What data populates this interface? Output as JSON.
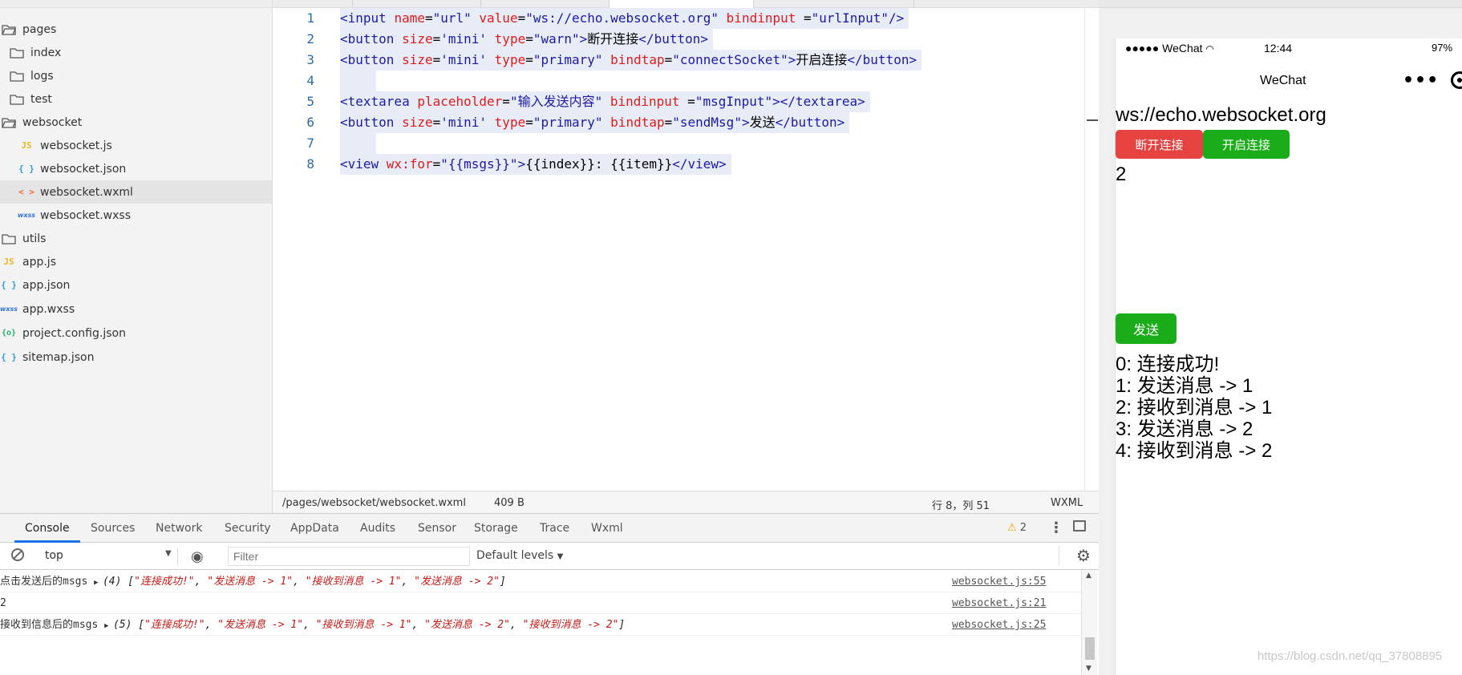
{
  "sidebar": {
    "items": [
      {
        "label": "pages",
        "type": "folder-open"
      },
      {
        "label": "index",
        "type": "folder"
      },
      {
        "label": "logs",
        "type": "folder"
      },
      {
        "label": "test",
        "type": "folder"
      },
      {
        "label": "websocket",
        "type": "folder-open"
      },
      {
        "label": "websocket.js",
        "type": "js",
        "icon_text": "JS"
      },
      {
        "label": "websocket.json",
        "type": "json",
        "icon_text": "{ }"
      },
      {
        "label": "websocket.wxml",
        "type": "wxml",
        "icon_text": "< >",
        "selected": true
      },
      {
        "label": "websocket.wxss",
        "type": "wxss",
        "icon_text": "wxss"
      },
      {
        "label": "utils",
        "type": "folder"
      },
      {
        "label": "app.js",
        "type": "js",
        "icon_text": "JS"
      },
      {
        "label": "app.json",
        "type": "json",
        "icon_text": "{ }"
      },
      {
        "label": "app.wxss",
        "type": "wxss",
        "icon_text": "wxss"
      },
      {
        "label": "project.config.json",
        "type": "config",
        "icon_text": "{o}"
      },
      {
        "label": "sitemap.json",
        "type": "json",
        "icon_text": "{ }"
      }
    ]
  },
  "editor": {
    "line_numbers": [
      "1",
      "2",
      "3",
      "4",
      "5",
      "6",
      "7",
      "8"
    ],
    "lines": [
      [
        {
          "t": "tg",
          "v": "<input "
        },
        {
          "t": "at",
          "v": "name"
        },
        {
          "t": "tx",
          "v": "="
        },
        {
          "t": "st",
          "v": "\"url\" "
        },
        {
          "t": "at",
          "v": "value"
        },
        {
          "t": "tx",
          "v": "="
        },
        {
          "t": "st",
          "v": "\"ws://echo.websocket.org\" "
        },
        {
          "t": "at",
          "v": "bindinput "
        },
        {
          "t": "tx",
          "v": "="
        },
        {
          "t": "st",
          "v": "\"urlInput\""
        },
        {
          "t": "tg",
          "v": "/>"
        }
      ],
      [
        {
          "t": "tg",
          "v": "<button "
        },
        {
          "t": "at",
          "v": "size"
        },
        {
          "t": "tx",
          "v": "="
        },
        {
          "t": "st",
          "v": "'mini' "
        },
        {
          "t": "at",
          "v": "type"
        },
        {
          "t": "tx",
          "v": "="
        },
        {
          "t": "st",
          "v": "\"warn\""
        },
        {
          "t": "tg",
          "v": ">"
        },
        {
          "t": "tx",
          "v": "断开连接"
        },
        {
          "t": "tg",
          "v": "</button>"
        }
      ],
      [
        {
          "t": "tg",
          "v": "<button "
        },
        {
          "t": "at",
          "v": "size"
        },
        {
          "t": "tx",
          "v": "="
        },
        {
          "t": "st",
          "v": "'mini' "
        },
        {
          "t": "at",
          "v": "type"
        },
        {
          "t": "tx",
          "v": "="
        },
        {
          "t": "st",
          "v": "\"primary\" "
        },
        {
          "t": "at",
          "v": "bindtap"
        },
        {
          "t": "tx",
          "v": "="
        },
        {
          "t": "st",
          "v": "\"connectSocket\""
        },
        {
          "t": "tg",
          "v": ">"
        },
        {
          "t": "tx",
          "v": "开启连接"
        },
        {
          "t": "tg",
          "v": "</button>"
        }
      ],
      [
        {
          "t": "tx",
          "v": "    "
        }
      ],
      [
        {
          "t": "tg",
          "v": "<textarea "
        },
        {
          "t": "at",
          "v": "placeholder"
        },
        {
          "t": "tx",
          "v": "="
        },
        {
          "t": "st",
          "v": "\"输入发送内容\" "
        },
        {
          "t": "at",
          "v": "bindinput "
        },
        {
          "t": "tx",
          "v": "="
        },
        {
          "t": "st",
          "v": "\"msgInput\""
        },
        {
          "t": "tg",
          "v": "></textarea>"
        }
      ],
      [
        {
          "t": "tg",
          "v": "<button "
        },
        {
          "t": "at",
          "v": "size"
        },
        {
          "t": "tx",
          "v": "="
        },
        {
          "t": "st",
          "v": "'mini' "
        },
        {
          "t": "at",
          "v": "type"
        },
        {
          "t": "tx",
          "v": "="
        },
        {
          "t": "st",
          "v": "\"primary\" "
        },
        {
          "t": "at",
          "v": "bindtap"
        },
        {
          "t": "tx",
          "v": "="
        },
        {
          "t": "st",
          "v": "\"sendMsg\""
        },
        {
          "t": "tg",
          "v": ">"
        },
        {
          "t": "tx",
          "v": "发送"
        },
        {
          "t": "tg",
          "v": "</button>"
        }
      ],
      [
        {
          "t": "tx",
          "v": "    "
        }
      ],
      [
        {
          "t": "tg",
          "v": "<view "
        },
        {
          "t": "at",
          "v": "wx:for"
        },
        {
          "t": "tx",
          "v": "="
        },
        {
          "t": "st",
          "v": "\"{{msgs}}\""
        },
        {
          "t": "tg",
          "v": ">"
        },
        {
          "t": "tx",
          "v": "{{index}}: {{item}}"
        },
        {
          "t": "tg",
          "v": "</view>"
        }
      ]
    ]
  },
  "statusbar": {
    "path": "/pages/websocket/websocket.wxml",
    "size": "409 B",
    "position": "行 8，列 51",
    "language": "WXML"
  },
  "devtools": {
    "tabs": [
      "Console",
      "Sources",
      "Network",
      "Security",
      "AppData",
      "Audits",
      "Sensor",
      "Storage",
      "Trace",
      "Wxml"
    ],
    "active_tab": "Console",
    "warning_count": "2",
    "context": "top",
    "filter_placeholder": "Filter",
    "levels": "Default levels",
    "logs": [
      {
        "prefix": "点击发送后的msgs ",
        "count": "(4) ",
        "items": [
          "\"连接成功!\"",
          "\"发送消息 -> 1\"",
          "\"接收到消息 -> 1\"",
          "\"发送消息 -> 2\""
        ],
        "source": "websocket.js:55"
      },
      {
        "prefix": "2",
        "count": "",
        "items": [],
        "source": "websocket.js:21"
      },
      {
        "prefix": "接收到信息后的msgs ",
        "count": "(5) ",
        "items": [
          "\"连接成功!\"",
          "\"发送消息 -> 1\"",
          "\"接收到消息 -> 1\"",
          "\"发送消息 -> 2\"",
          "\"接收到消息 -> 2\""
        ],
        "source": "websocket.js:25"
      }
    ]
  },
  "simulator": {
    "signal": "●●●●● WeChat",
    "time": "12:44",
    "battery": "97%",
    "nav_title": "WeChat",
    "nav_dots": "•••",
    "url_value": "ws://echo.websocket.org",
    "disconnect_label": "断开连接",
    "connect_label": "开启连接",
    "input_value": "2",
    "send_label": "发送",
    "messages": [
      "0: 连接成功!",
      "1: 发送消息 -> 1",
      "2: 接收到消息 -> 1",
      "3: 发送消息 -> 2",
      "4: 接收到消息 -> 2"
    ]
  },
  "watermark": "https://blog.csdn.net/qq_37808895"
}
